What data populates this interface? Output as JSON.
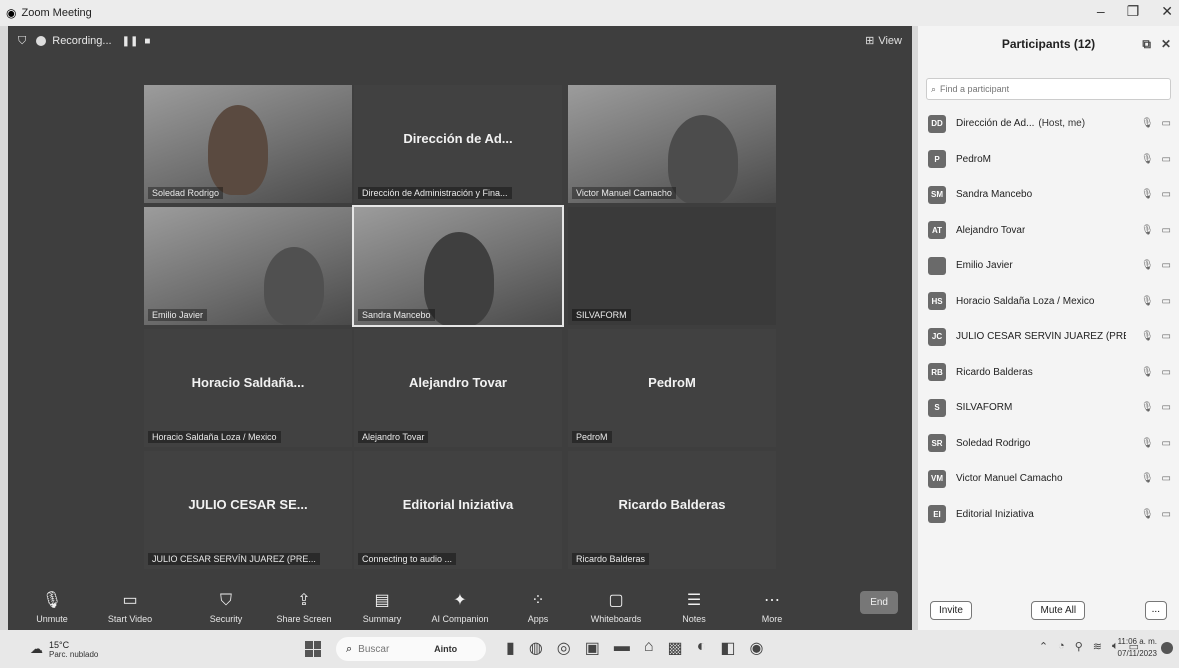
{
  "window": {
    "title": "Zoom Meeting"
  },
  "meeting_bar": {
    "recording_label": "Recording...",
    "view_label": "View"
  },
  "tiles": [
    {
      "big_name": "",
      "tag": "Soledad Rodrigo",
      "video": true
    },
    {
      "big_name": "Dirección de Ad...",
      "tag": "Dirección de Administración y Fina...",
      "video": false
    },
    {
      "big_name": "",
      "tag": "Victor Manuel Camacho",
      "video": true
    },
    {
      "big_name": "",
      "tag": "Emilio Javier",
      "video": true
    },
    {
      "big_name": "",
      "tag": "Sandra Mancebo",
      "video": true
    },
    {
      "big_name": "",
      "tag": "SILVAFORM",
      "video": false
    },
    {
      "big_name": "Horacio Saldaña...",
      "tag": "Horacio Saldaña Loza / Mexico",
      "video": false
    },
    {
      "big_name": "Alejandro Tovar",
      "tag": "Alejandro Tovar",
      "video": false
    },
    {
      "big_name": "PedroM",
      "tag": "PedroM",
      "video": false
    },
    {
      "big_name": "JULIO CESAR SE...",
      "tag": "JULIO CESAR SERVÍN JUAREZ (PRE...",
      "video": false
    },
    {
      "big_name": "Editorial Iniziativa",
      "tag": "Connecting to audio ...",
      "video": false
    },
    {
      "big_name": "Ricardo Balderas",
      "tag": "Ricardo Balderas",
      "video": false
    }
  ],
  "toolbar": {
    "unmute": "Unmute",
    "start_video": "Start Video",
    "security": "Security",
    "share_screen": "Share Screen",
    "summary": "Summary",
    "ai_companion": "AI Companion",
    "apps": "Apps",
    "whiteboards": "Whiteboards",
    "notes": "Notes",
    "more": "More",
    "end": "End"
  },
  "participants": {
    "title": "Participants (12)",
    "search_placeholder": "Find a participant",
    "items": [
      {
        "initials": "DD",
        "name": "Dirección de Ad...",
        "tag": "(Host, me)"
      },
      {
        "initials": "P",
        "name": "PedroM",
        "tag": ""
      },
      {
        "initials": "SM",
        "name": "Sandra Mancebo",
        "tag": ""
      },
      {
        "initials": "AT",
        "name": "Alejandro Tovar",
        "tag": ""
      },
      {
        "initials": "",
        "name": "Emilio Javier",
        "tag": ""
      },
      {
        "initials": "HS",
        "name": "Horacio Saldaña Loza / Mexico",
        "tag": ""
      },
      {
        "initials": "JC",
        "name": "JULIO CESAR SERVÍN JUAREZ (PRESE...",
        "tag": ""
      },
      {
        "initials": "RB",
        "name": "Ricardo Balderas",
        "tag": ""
      },
      {
        "initials": "S",
        "name": "SILVAFORM",
        "tag": ""
      },
      {
        "initials": "SR",
        "name": "Soledad Rodrigo",
        "tag": ""
      },
      {
        "initials": "VM",
        "name": "Victor Manuel Camacho",
        "tag": ""
      },
      {
        "initials": "EI",
        "name": "Editorial Iniziativa",
        "tag": ""
      }
    ],
    "invite_label": "Invite",
    "mute_all_label": "Mute All",
    "more_label": "..."
  },
  "taskbar": {
    "temp": "15°C",
    "weather": "Parc. nublado",
    "search_placeholder": "Buscar",
    "search_badge": "Ainto",
    "time": "11:06 a. m.",
    "date": "07/11/2023"
  }
}
